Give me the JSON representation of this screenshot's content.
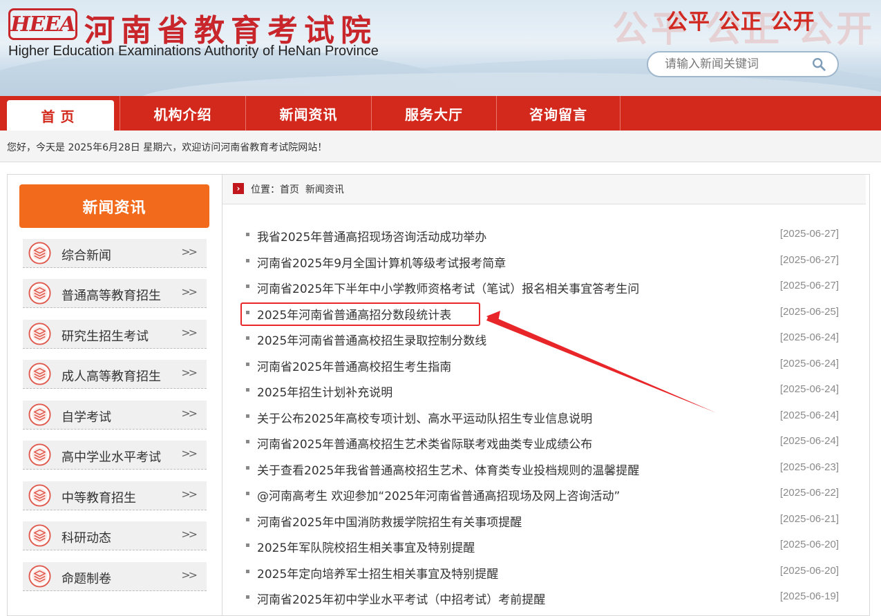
{
  "header": {
    "logo_text": "HEEA",
    "title_cn": "河南省教育考试院",
    "title_en": "Higher Education Examinations Authority of HeNan Province",
    "slogan": "公平 公正 公开",
    "search_placeholder": "请输入新闻关键词"
  },
  "nav": {
    "items": [
      {
        "label": "首页"
      },
      {
        "label": "机构介绍"
      },
      {
        "label": "新闻资讯"
      },
      {
        "label": "服务大厅"
      },
      {
        "label": "咨询留言"
      }
    ]
  },
  "greeting": "您好，今天是 2025年6月28日 星期六，欢迎访问河南省教育考试院网站！",
  "sidebar": {
    "title": "新闻资讯",
    "arrow": ">>",
    "items": [
      {
        "label": "综合新闻"
      },
      {
        "label": "普通高等教育招生"
      },
      {
        "label": "研究生招生考试"
      },
      {
        "label": "成人高等教育招生"
      },
      {
        "label": "自学考试"
      },
      {
        "label": "高中学业水平考试"
      },
      {
        "label": "中等教育招生"
      },
      {
        "label": "科研动态"
      },
      {
        "label": "命题制卷"
      }
    ]
  },
  "breadcrumb": {
    "prefix": "位置：",
    "home": "首页",
    "current": "新闻资讯"
  },
  "news": [
    {
      "title": "我省2025年普通高招现场咨询活动成功举办",
      "date": "[2025-06-27]"
    },
    {
      "title": "河南省2025年9月全国计算机等级考试报考简章",
      "date": "[2025-06-27]"
    },
    {
      "title": "河南省2025年下半年中小学教师资格考试（笔试）报名相关事宜答考生问",
      "date": "[2025-06-27]"
    },
    {
      "title": "2025年河南省普通高招分数段统计表",
      "date": "[2025-06-25]",
      "highlighted": true
    },
    {
      "title": "2025年河南省普通高校招生录取控制分数线",
      "date": "[2025-06-24]"
    },
    {
      "title": "河南省2025年普通高校招生考生指南",
      "date": "[2025-06-24]"
    },
    {
      "title": "2025年招生计划补充说明",
      "date": "[2025-06-24]"
    },
    {
      "title": "关于公布2025年高校专项计划、高水平运动队招生专业信息说明",
      "date": "[2025-06-24]"
    },
    {
      "title": "河南省2025年普通高校招生艺术类省际联考戏曲类专业成绩公布",
      "date": "[2025-06-24]"
    },
    {
      "title": "关于查看2025年我省普通高校招生艺术、体育类专业投档规则的温馨提醒",
      "date": "[2025-06-23]"
    },
    {
      "title": "@河南高考生 欢迎参加“2025年河南省普通高招现场及网上咨询活动”",
      "date": "[2025-06-22]"
    },
    {
      "title": "河南省2025年中国消防救援学院招生有关事项提醒",
      "date": "[2025-06-21]"
    },
    {
      "title": "2025年军队院校招生相关事宜及特别提醒",
      "date": "[2025-06-20]"
    },
    {
      "title": "2025年定向培养军士招生相关事宜及特别提醒",
      "date": "[2025-06-20]"
    },
    {
      "title": "河南省2025年初中学业水平考试（中招考试）考前提醒",
      "date": "[2025-06-19]"
    }
  ],
  "colors": {
    "brand_red": "#d3291c",
    "sidebar_orange": "#f26b1d",
    "highlight_red": "#e8262a"
  }
}
